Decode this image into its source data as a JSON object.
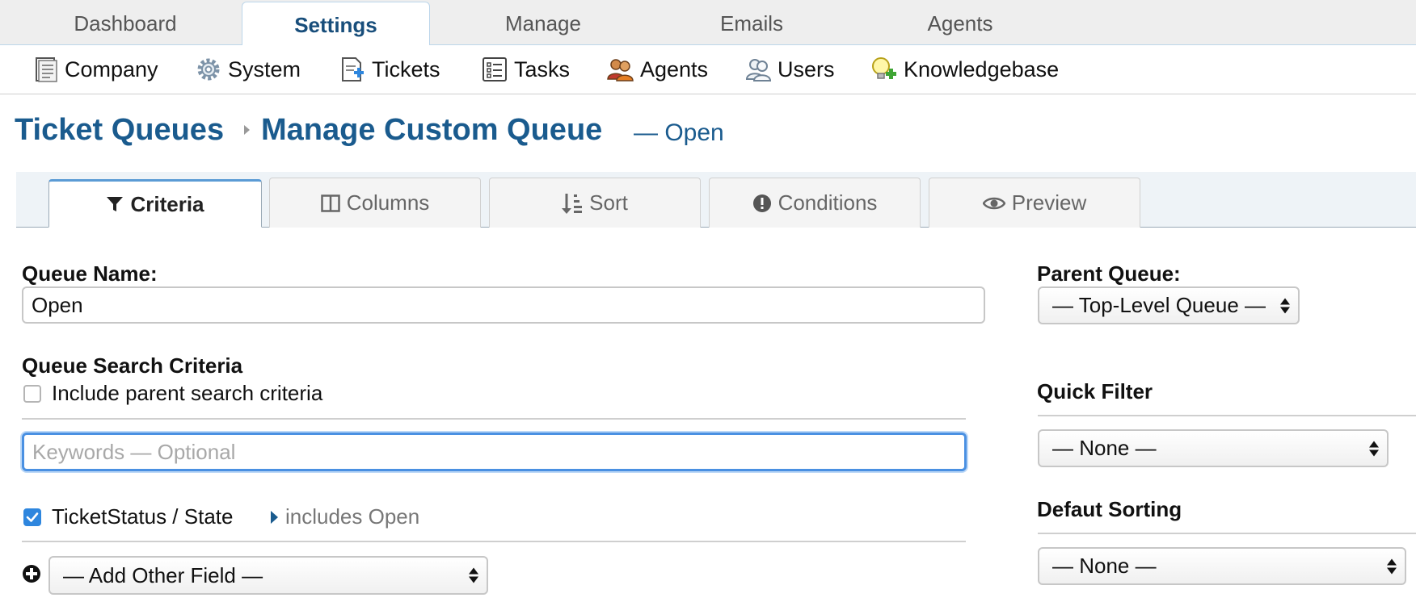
{
  "top_nav": {
    "tabs": [
      "Dashboard",
      "Settings",
      "Manage",
      "Emails",
      "Agents"
    ],
    "active": "Settings"
  },
  "sub_nav": {
    "items": [
      {
        "label": "Company",
        "icon": "company-icon"
      },
      {
        "label": "System",
        "icon": "gear-icon"
      },
      {
        "label": "Tickets",
        "icon": "ticket-icon"
      },
      {
        "label": "Tasks",
        "icon": "tasks-icon"
      },
      {
        "label": "Agents",
        "icon": "agents-icon"
      },
      {
        "label": "Users",
        "icon": "users-icon"
      },
      {
        "label": "Knowledgebase",
        "icon": "knowledgebase-icon"
      }
    ]
  },
  "breadcrumb": {
    "parent": "Ticket Queues",
    "current": "Manage Custom Queue",
    "suffix": "— Open"
  },
  "queue_tabs": {
    "items": [
      {
        "label": "Criteria",
        "icon": "filter-icon"
      },
      {
        "label": "Columns",
        "icon": "columns-icon"
      },
      {
        "label": "Sort",
        "icon": "sort-icon"
      },
      {
        "label": "Conditions",
        "icon": "exclamation-icon"
      },
      {
        "label": "Preview",
        "icon": "eye-icon"
      }
    ],
    "active": "Criteria"
  },
  "form": {
    "queue_name_label": "Queue Name:",
    "queue_name_value": "Open",
    "search_criteria_heading": "Queue Search Criteria",
    "include_parent_label": "Include parent search criteria",
    "include_parent_checked": false,
    "keywords_placeholder": "Keywords — Optional",
    "criteria_field": "TicketStatus / State",
    "criteria_field_checked": true,
    "criteria_summary": "includes Open",
    "add_field_select": "— Add Other Field —"
  },
  "sidebar": {
    "parent_queue_label": "Parent Queue:",
    "parent_queue_value": "— Top-Level Queue —",
    "quick_filter_label": "Quick Filter",
    "quick_filter_value": "— None —",
    "default_sorting_label": "Defaut Sorting",
    "default_sorting_value": "— None —"
  },
  "colors": {
    "brand_blue": "#1a5b8e",
    "focus_blue": "#4a90e2",
    "checkbox_blue": "#2e86de"
  }
}
